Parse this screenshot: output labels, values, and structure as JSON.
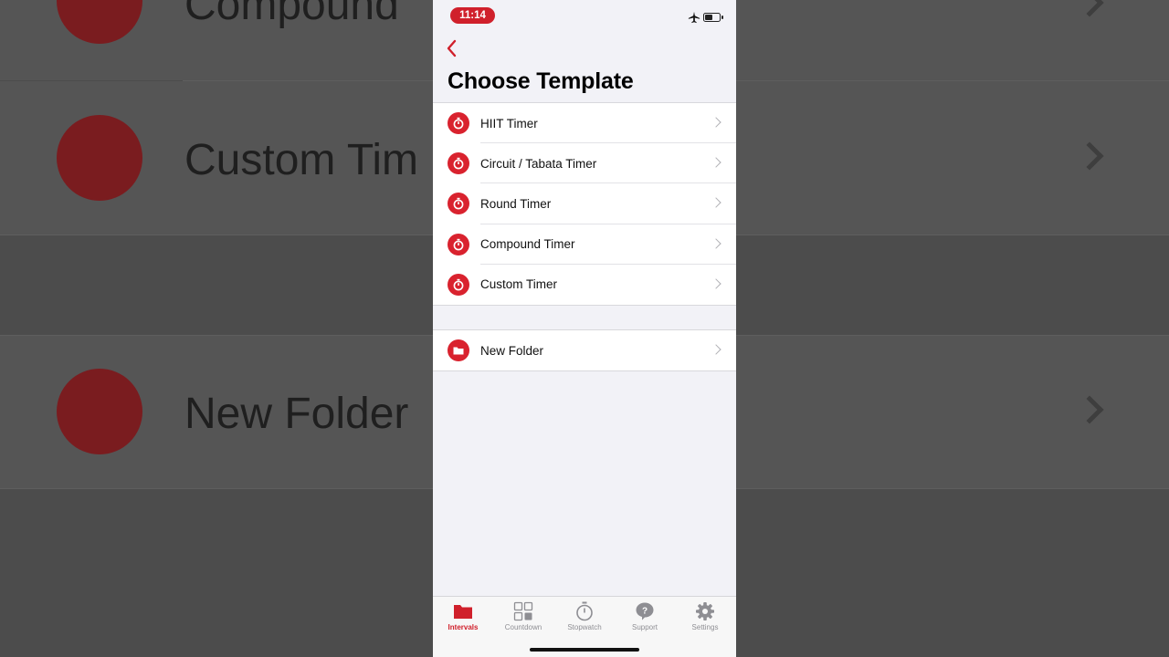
{
  "status_bar": {
    "time": "11:14"
  },
  "header": {
    "title": "Choose Template"
  },
  "templates": [
    {
      "label": "HIIT Timer",
      "icon": "stopwatch-icon"
    },
    {
      "label": "Circuit / Tabata Timer",
      "icon": "stopwatch-icon"
    },
    {
      "label": "Round Timer",
      "icon": "stopwatch-icon"
    },
    {
      "label": "Compound Timer",
      "icon": "stopwatch-icon"
    },
    {
      "label": "Custom Timer",
      "icon": "stopwatch-icon"
    }
  ],
  "folder": {
    "label": "New Folder",
    "icon": "folder-icon"
  },
  "tabs": [
    {
      "label": "Intervals",
      "icon": "folder-icon",
      "active": true
    },
    {
      "label": "Countdown",
      "icon": "grid-icon",
      "active": false
    },
    {
      "label": "Stopwatch",
      "icon": "stopwatch-icon",
      "active": false
    },
    {
      "label": "Support",
      "icon": "question-bubble-icon",
      "active": false
    },
    {
      "label": "Settings",
      "icon": "gear-icon",
      "active": false
    }
  ],
  "background": {
    "labels": [
      "Compound",
      "Custom Tim",
      "New Folder"
    ]
  },
  "colors": {
    "accent": "#d0202b",
    "background": "#f2f2f7",
    "inactive": "#8e8e93"
  }
}
